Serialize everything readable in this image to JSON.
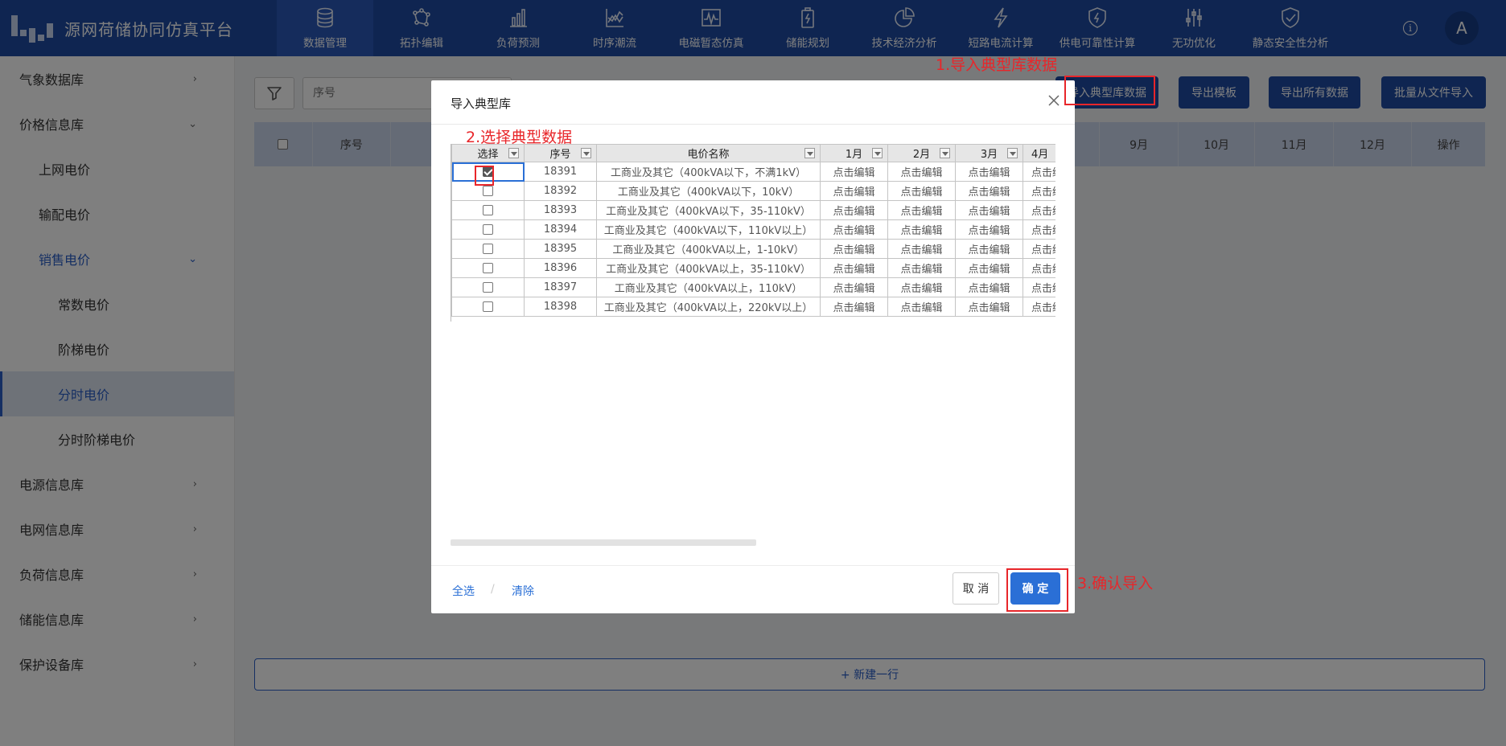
{
  "app": {
    "title": "源网荷储协同仿真平台"
  },
  "nav": [
    {
      "label": "数据管理",
      "icon": "database-icon",
      "active": true
    },
    {
      "label": "拓扑编辑",
      "icon": "topology-icon"
    },
    {
      "label": "负荷预测",
      "icon": "bar-chart-icon"
    },
    {
      "label": "时序潮流",
      "icon": "line-chart-icon"
    },
    {
      "label": "电磁暂态仿真",
      "icon": "waveform-icon"
    },
    {
      "label": "储能规划",
      "icon": "battery-icon"
    },
    {
      "label": "技术经济分析",
      "icon": "pie-chart-icon"
    },
    {
      "label": "短路电流计算",
      "icon": "lightning-icon"
    },
    {
      "label": "供电可靠性计算",
      "icon": "shield-lightning-icon"
    },
    {
      "label": "无功优化",
      "icon": "sliders-icon"
    },
    {
      "label": "静态安全性分析",
      "icon": "shield-check-icon"
    }
  ],
  "user": {
    "avatar": "A",
    "info_icon": "i"
  },
  "sidebar": [
    {
      "label": "气象数据库",
      "level": 1,
      "chev": "›"
    },
    {
      "label": "价格信息库",
      "level": 1,
      "chev": "⌄"
    },
    {
      "label": "上网电价",
      "level": 2
    },
    {
      "label": "输配电价",
      "level": 2
    },
    {
      "label": "销售电价",
      "level": 2,
      "chev": "⌄",
      "blue": true
    },
    {
      "label": "常数电价",
      "level": 3
    },
    {
      "label": "阶梯电价",
      "level": 3
    },
    {
      "label": "分时电价",
      "level": 3,
      "selected": true
    },
    {
      "label": "分时阶梯电价",
      "level": 3
    },
    {
      "label": "电源信息库",
      "level": 1,
      "chev": "›"
    },
    {
      "label": "电网信息库",
      "level": 1,
      "chev": "›"
    },
    {
      "label": "负荷信息库",
      "level": 1,
      "chev": "›"
    },
    {
      "label": "储能信息库",
      "level": 1,
      "chev": "›"
    },
    {
      "label": "保护设备库",
      "level": 1,
      "chev": "›"
    }
  ],
  "toolbar": {
    "search_placeholder": "序号",
    "import_typical": "导入典型库数据",
    "export_template": "导出模板",
    "export_all": "导出所有数据",
    "batch_import": "批量从文件导入"
  },
  "main_table": {
    "headers": [
      "序号",
      "9月",
      "10月",
      "11月",
      "12月",
      "操作"
    ]
  },
  "new_row": "+ 新建一行",
  "modal": {
    "title": "导入典型库",
    "close": "X",
    "columns": [
      "选择",
      "序号",
      "电价名称",
      "1月",
      "2月",
      "3月",
      "4月"
    ],
    "edit_text": "点击编辑",
    "rows": [
      {
        "checked": true,
        "id": "18391",
        "name": "工商业及其它（400kVA以下，不满1kV）"
      },
      {
        "checked": false,
        "id": "18392",
        "name": "工商业及其它（400kVA以下，10kV）"
      },
      {
        "checked": false,
        "id": "18393",
        "name": "工商业及其它（400kVA以下，35-110kV）"
      },
      {
        "checked": false,
        "id": "18394",
        "name": "工商业及其它（400kVA以下，110kV以上）"
      },
      {
        "checked": false,
        "id": "18395",
        "name": "工商业及其它（400kVA以上，1-10kV）"
      },
      {
        "checked": false,
        "id": "18396",
        "name": "工商业及其它（400kVA以上，35-110kV）"
      },
      {
        "checked": false,
        "id": "18397",
        "name": "工商业及其它（400kVA以上，110kV）"
      },
      {
        "checked": false,
        "id": "18398",
        "name": "工商业及其它（400kVA以上，220kV以上）"
      }
    ],
    "select_all": "全选",
    "separator": "/",
    "clear": "清除",
    "cancel": "取 消",
    "ok": "确 定"
  },
  "annotations": {
    "step1": "1.导入典型库数据",
    "step2": "2.选择典型数据",
    "step3": "3.确认导入"
  },
  "colors": {
    "nav_bg": "#1e4ba3",
    "accent": "#2a6fd6",
    "annotation": "#e8262a"
  }
}
